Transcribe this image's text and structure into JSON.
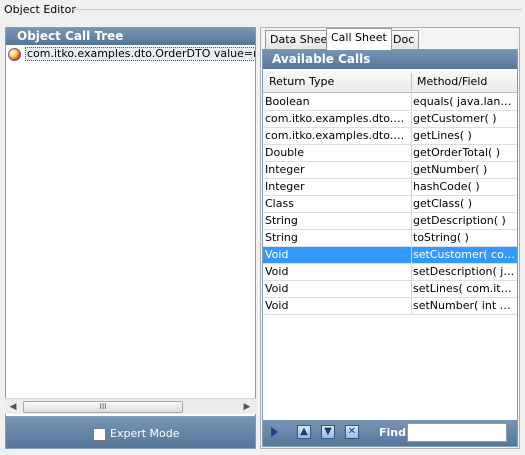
{
  "window": {
    "title": "Object Editor"
  },
  "left_panel": {
    "title": "Object Call Tree",
    "tree_item": "com.itko.examples.dto.OrderDTO value=number",
    "scroll_grip": "III",
    "expert_mode_label": "Expert Mode"
  },
  "tabs": [
    "Data Sheet",
    "Call Sheet",
    "Doc"
  ],
  "active_tab": "Call Sheet",
  "calls": {
    "title": "Available Calls",
    "columns": [
      "Return Type",
      "Method/Field"
    ],
    "rows": [
      [
        "Boolean",
        "equals( java.lang.Object )"
      ],
      [
        "com.itko.examples.dto.Customer",
        "getCustomer( )"
      ],
      [
        "com.itko.examples.dto.OrderLine[]",
        "getLines( )"
      ],
      [
        "Double",
        "getOrderTotal( )"
      ],
      [
        "Integer",
        "getNumber( )"
      ],
      [
        "Integer",
        "hashCode( )"
      ],
      [
        "Class",
        "getClass( )"
      ],
      [
        "String",
        "getDescription( )"
      ],
      [
        "String",
        "toString( )"
      ],
      [
        "Void",
        "setCustomer( com.itko.examples.dto.Customer )"
      ],
      [
        "Void",
        "setDescription( java.lang.String )"
      ],
      [
        "Void",
        "setLines( com.itko.examples.dto.OrderLine[] )"
      ],
      [
        "Void",
        "setNumber( int number )"
      ]
    ],
    "selected_row": 9
  },
  "toolbar": {
    "find_label": "Find:",
    "find_value": "",
    "icons": [
      "run-icon",
      "move-up-icon",
      "move-down-icon",
      "delete-icon"
    ]
  },
  "colors": {
    "header_blue": "#56779b",
    "selection": "#3399ff"
  }
}
